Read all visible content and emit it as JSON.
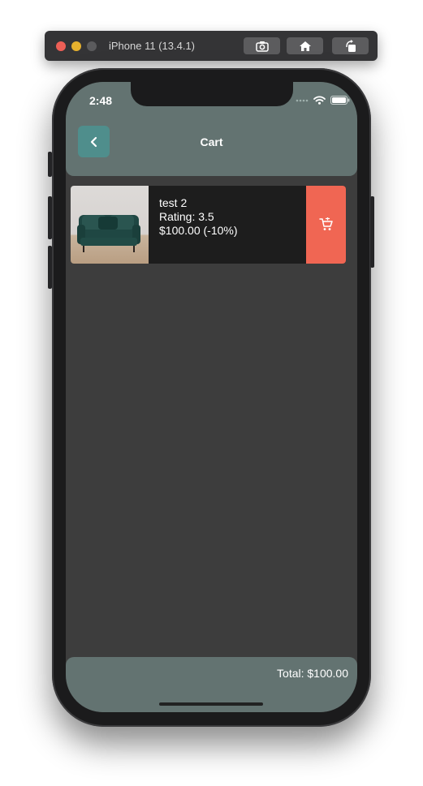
{
  "simulator": {
    "title": "iPhone 11 (13.4.1)",
    "buttons": [
      "screenshot-icon",
      "home-icon",
      "rotate-icon"
    ]
  },
  "status_bar": {
    "time": "2:48",
    "icons": [
      "signal-icon",
      "wifi-icon",
      "battery-icon"
    ]
  },
  "header": {
    "title": "Cart",
    "back_icon": "chevron-left-icon"
  },
  "cart": {
    "items": [
      {
        "name": "test 2",
        "rating": "Rating: 3.5",
        "price": "$100.00 (-10%)",
        "image": "green-sofa-photo",
        "action_icon": "cart-remove-icon"
      }
    ]
  },
  "footer": {
    "total": "Total: $100.00"
  },
  "colors": {
    "header_bg": "#637371",
    "back_button": "#4f8e8c",
    "screen_bg": "#3d3d3d",
    "card_bg": "#1d1d1d",
    "remove_button": "#f06653"
  }
}
